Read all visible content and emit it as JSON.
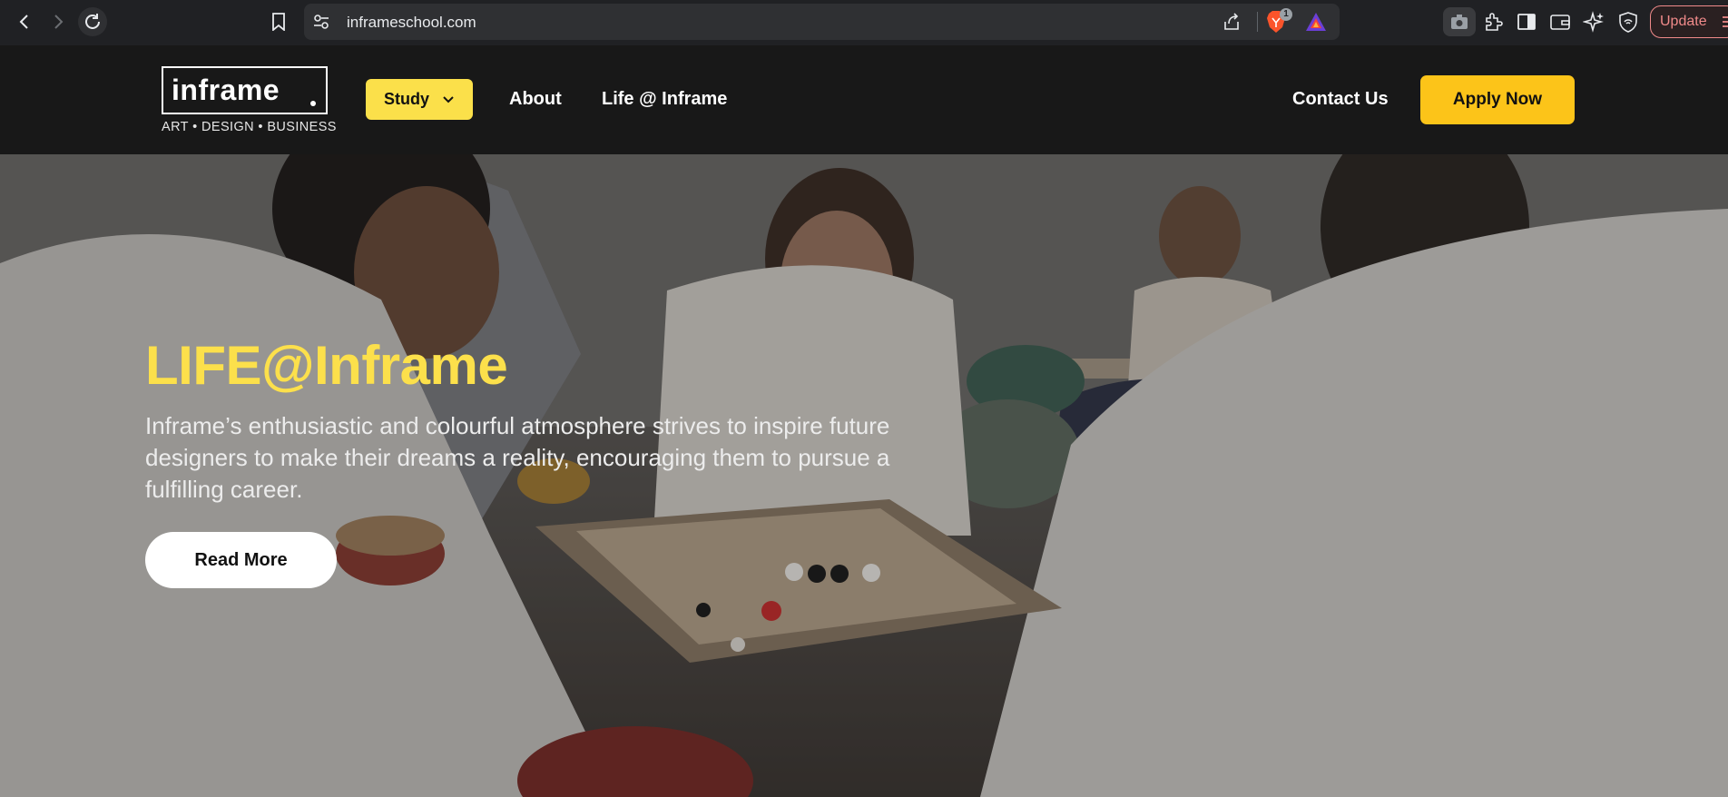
{
  "browser": {
    "url": "inframeschool.com",
    "shields_count": "1",
    "update_label": "Update"
  },
  "header": {
    "logo_word": "inframe",
    "logo_tagline": "ART • DESIGN • BUSINESS",
    "study_label": "Study",
    "about_label": "About",
    "life_label": "Life @ Inframe",
    "contact_label": "Contact Us",
    "apply_label": "Apply Now"
  },
  "hero": {
    "title": "LIFE@Inframe",
    "description": "Inframe’s enthusiastic and colourful atmosphere strives to inspire future designers to make their dreams a reality, encouraging them to pursue a fulfilling career.",
    "read_more_label": "Read More"
  },
  "colors": {
    "brand_yellow": "#fce04b",
    "apply_yellow": "#fcc419",
    "header_bg": "#181818"
  }
}
